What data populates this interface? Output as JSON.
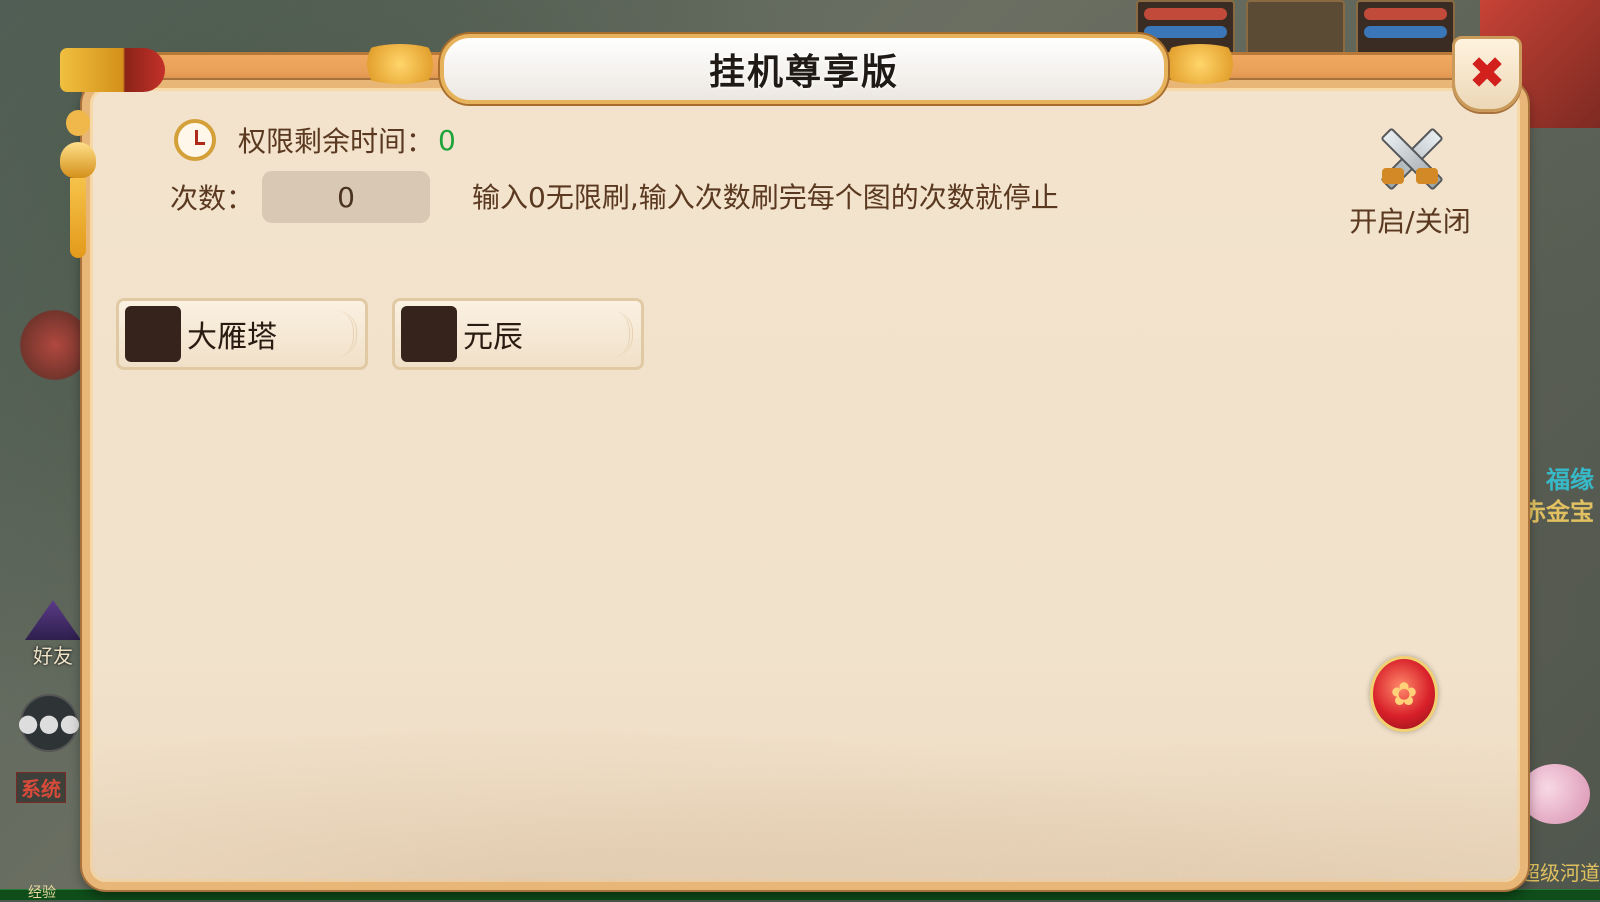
{
  "dialog": {
    "title": "挂机尊享版",
    "close_icon": "close-x-icon",
    "timer_label": "权限剩余时间：",
    "timer_value": "0",
    "count_label": "次数：",
    "count_value": "0",
    "hint": "输入0无限刷,输入次数刷完每个图的次数就停止",
    "toggle_label": "开启/关闭",
    "toggle_icon": "crossed-swords-icon",
    "maps": [
      {
        "label": "大雁塔",
        "checked": false
      },
      {
        "label": "元辰",
        "checked": false
      }
    ],
    "orb_icon": "phoenix-orb-icon"
  },
  "background": {
    "friends_label": "好友",
    "system_tag": "系统",
    "exp_label": "经验",
    "right_text_1": "福缘",
    "right_text_2": "赤金宝",
    "right_bottom": "超级河道"
  },
  "colors": {
    "panel_bg": "#f1e2cc",
    "panel_border": "#e8b777",
    "timer_value_color": "#1fa33a",
    "close_x": "#d2201c",
    "text_brown": "#5a3920"
  }
}
